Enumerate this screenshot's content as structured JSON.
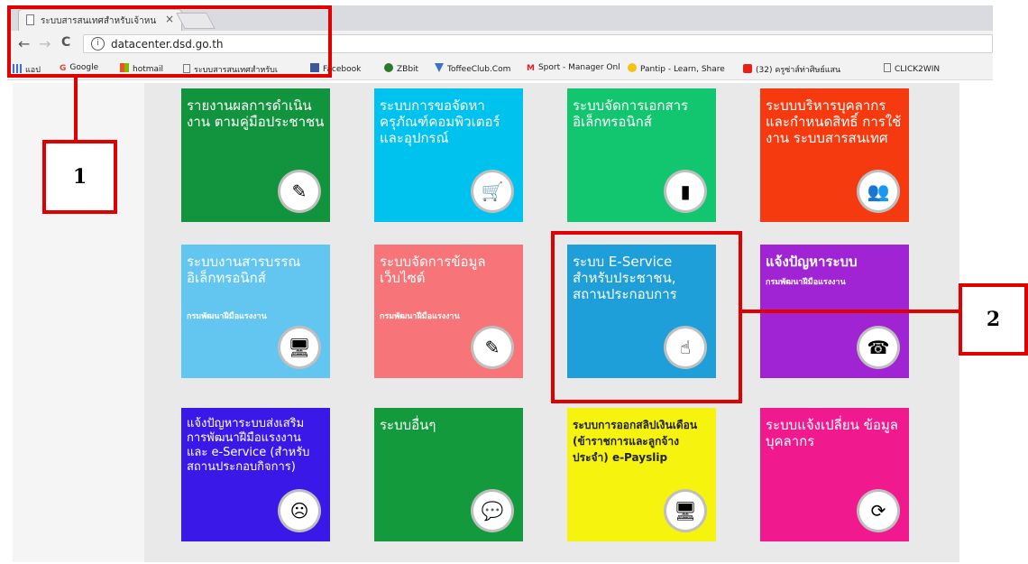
{
  "browser": {
    "tab_title": "ระบบสารสนเทศสำหรับเจ้าหน",
    "tab_close": "×",
    "back": "←",
    "forward": "→",
    "reload": "C",
    "info": "i",
    "url": "datacenter.dsd.go.th",
    "bookmarks": [
      {
        "label": "แอป",
        "icon": "apps-grid-icon"
      },
      {
        "label": "Google",
        "icon": "google-icon"
      },
      {
        "label": "hotmail",
        "icon": "windows-icon"
      },
      {
        "label": "ระบบสารสนเทศสำหรับเ",
        "icon": "page-icon"
      },
      {
        "label": "Facebook",
        "icon": "facebook-icon"
      },
      {
        "label": "ZBbit",
        "icon": "zbbit-icon"
      },
      {
        "label": "ToffeeClub.Com",
        "icon": "toffee-icon"
      },
      {
        "label": "Sport - Manager Onl",
        "icon": "gmail-icon"
      },
      {
        "label": "Pantip - Learn, Share",
        "icon": "pantip-icon"
      },
      {
        "label": "(32) ครูซ่าส์ท่าศิษย์แสน",
        "icon": "youtube-icon"
      },
      {
        "label": "CLICK2WIN",
        "icon": "page-icon"
      }
    ]
  },
  "annotations": {
    "label1": "1",
    "label2": "2"
  },
  "tiles": [
    {
      "title": "รายงานผลการดำเนินงาน ตามคู่มือประชาชน",
      "sub": "",
      "color": "#12943f",
      "icon": "document-pen-icon"
    },
    {
      "title": "ระบบการขอจัดหา ครุภัณฑ์คอมพิวเตอร์ และอุปกรณ์",
      "sub": "",
      "color": "#00c2ee",
      "icon": "tablet-cart-icon"
    },
    {
      "title": "ระบบจัดการเอกสาร อิเล็กทรอนิกส์",
      "sub": "",
      "color": "#12c56f",
      "icon": "folder-icon"
    },
    {
      "title": "ระบบบริหารบุคลากร และกำหนดสิทธิ์ การใช้งาน ระบบสารสนเทศ",
      "sub": "",
      "color": "#f43a0e",
      "icon": "people-icon"
    },
    {
      "title": "ระบบงานสารบรรณ อิเล็กทรอนิกส์",
      "sub": "กรมพัฒนาฝีมือแรงงาน",
      "color": "#63c6f1",
      "icon": "desk-icon"
    },
    {
      "title": "ระบบจัดการข้อมูล เว็บไซต์",
      "sub": "กรมพัฒนาฝีมือแรงงาน",
      "color": "#f77479",
      "icon": "edit-document-icon"
    },
    {
      "title": "ระบบ E-Service สำหรับประชาชน, สถานประกอบการ",
      "sub": "",
      "color": "#1f9fd9",
      "icon": "web-click-icon"
    },
    {
      "title": "แจ้งปัญหาระบบ",
      "sub": "กรมพัฒนาฝีมือแรงงาน",
      "color": "#a124d4",
      "icon": "support-agent-icon"
    },
    {
      "title": "แจ้งปัญหาระบบส่งเสริม การพัฒนาฝีมือแรงงาน และ e-Service (สำหรับสถานประกอบกิจการ)",
      "sub": "",
      "color": "#3a19e8",
      "icon": "sad-face-icon"
    },
    {
      "title": "ระบบอื่นๆ",
      "sub": "",
      "color": "#139a3c",
      "icon": "chat-bubble-icon"
    },
    {
      "title": "ระบบการออกสลิปเงินเดือน (ข้าราชการและลูกจ้างประจำ) e-Payslip",
      "sub": "",
      "color": "#f6f40e",
      "icon": "e-statement-icon"
    },
    {
      "title": "ระบบแจ้งเปลี่ยน ข้อมูลบุคลากร",
      "sub": "",
      "color": "#f01a8e",
      "icon": "people-cycle-icon"
    }
  ]
}
